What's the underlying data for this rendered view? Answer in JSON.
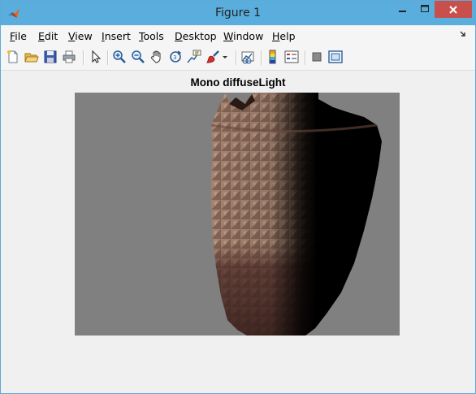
{
  "window": {
    "title": "Figure 1"
  },
  "menu": [
    {
      "label": "File",
      "ul": "F",
      "rest": "ile"
    },
    {
      "label": "Edit",
      "ul": "E",
      "rest": "dit"
    },
    {
      "label": "View",
      "ul": "V",
      "rest": "iew"
    },
    {
      "label": "Insert",
      "ul": "I",
      "rest": "nsert"
    },
    {
      "label": "Tools",
      "ul": "T",
      "rest": "ools"
    },
    {
      "label": "Desktop",
      "ul": "D",
      "rest": "esktop"
    },
    {
      "label": "Window",
      "ul": "W",
      "rest": "indow"
    },
    {
      "label": "Help",
      "ul": "H",
      "rest": "elp"
    }
  ],
  "toolbar": {
    "icons": [
      "new-figure-icon",
      "open-file-icon",
      "save-icon",
      "print-icon",
      "edit-plot-arrow-icon",
      "zoom-in-icon",
      "zoom-out-icon",
      "pan-hand-icon",
      "rotate-3d-icon",
      "data-cursor-icon",
      "brush-icon",
      "brush-dropdown-icon",
      "link-plot-icon",
      "colorbar-icon",
      "legend-icon",
      "hide-plot-tools-icon",
      "show-plot-tools-icon"
    ]
  },
  "figure": {
    "title": "Mono diffuseLight",
    "axes_background": "#808080"
  },
  "colors": {
    "titlebar": "#5aaedd",
    "close_button": "#c7504c",
    "object_lit": "#9a7a68",
    "object_shadow": "#000000"
  }
}
